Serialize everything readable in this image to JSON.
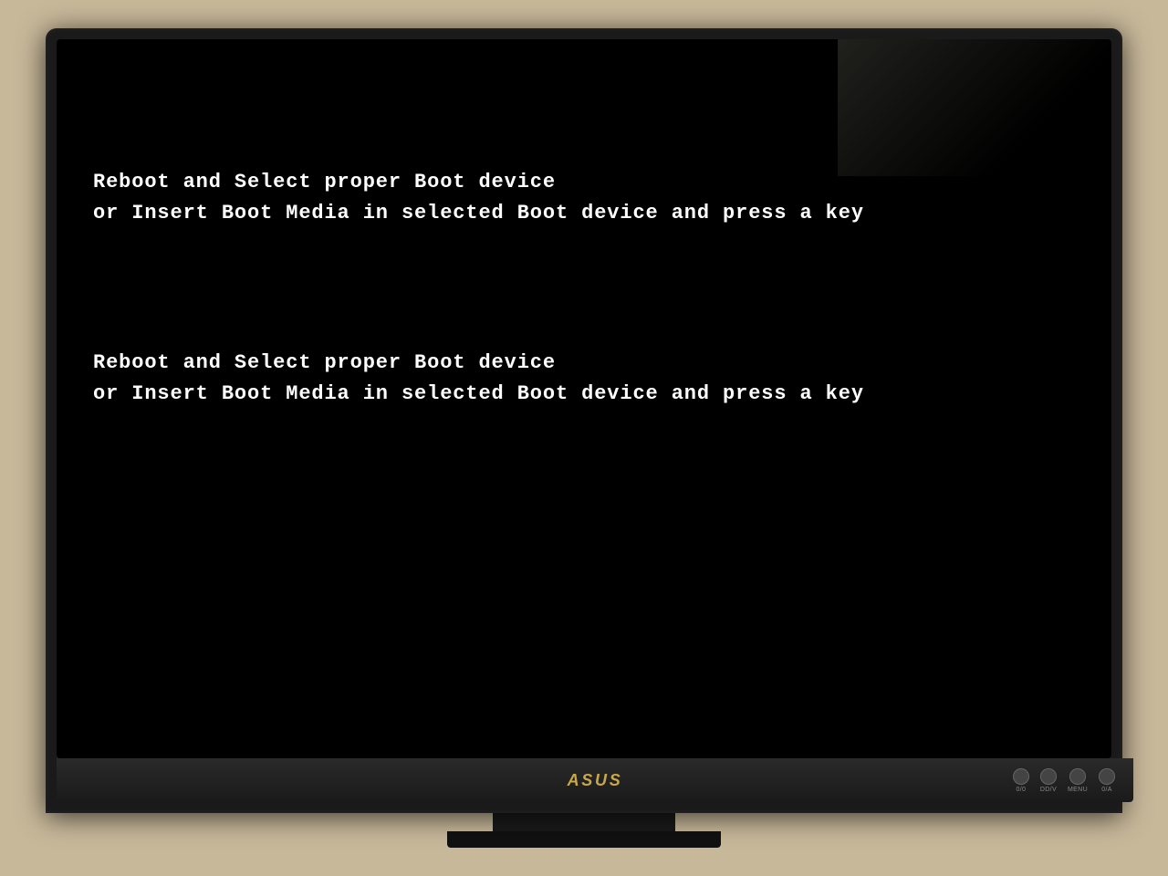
{
  "monitor": {
    "brand": "/lSUS",
    "brand_display": "ASUS"
  },
  "screen": {
    "background_color": "#000000",
    "error_messages": [
      {
        "id": "error-1",
        "line1": "Reboot and Select proper Boot device",
        "line2": "or Insert Boot Media in selected Boot device and press a key"
      },
      {
        "id": "error-2",
        "line1": "Reboot and Select proper Boot device",
        "line2": "or Insert Boot Media in selected Boot device and press a key"
      }
    ]
  },
  "bottom_bar": {
    "icons": [
      {
        "label": "0/0"
      },
      {
        "label": "DD/V"
      },
      {
        "label": "MENU"
      },
      {
        "label": "0/A"
      }
    ]
  }
}
